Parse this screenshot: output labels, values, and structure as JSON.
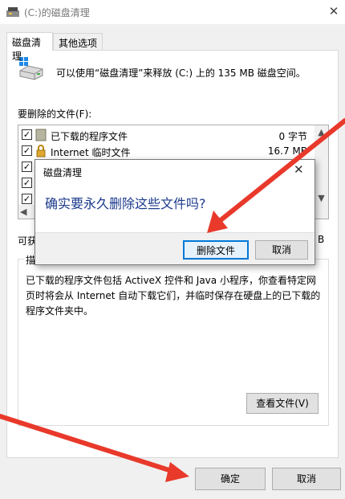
{
  "window": {
    "title": "(C:)的磁盘清理",
    "close_glyph": "✕"
  },
  "tabs": [
    {
      "label": "磁盘清理",
      "active": true
    },
    {
      "label": "其他选项",
      "active": false
    }
  ],
  "info_text": "可以使用“磁盘清理”来释放  (C:) 上的 135 MB 磁盘空间。",
  "files_label": "要删除的文件(F):",
  "file_list": [
    {
      "checked": true,
      "icon": "folder-icon",
      "name": "已下载的程序文件",
      "size": "0 字节"
    },
    {
      "checked": true,
      "icon": "lock-icon",
      "name": "Internet 临时文件",
      "size": "16.7 MB"
    },
    {
      "checked": true,
      "icon": "",
      "name": "",
      "size": ""
    },
    {
      "checked": true,
      "icon": "",
      "name": "",
      "size": ""
    },
    {
      "checked": true,
      "icon": "",
      "name": "",
      "size": ""
    }
  ],
  "obtain_label": "可获",
  "obtain_size": "B",
  "description": {
    "label": "描",
    "text": "已下载的程序文件包括 ActiveX 控件和 Java 小程序，你查看特定网页时将会从 Internet 自动下载它们，并临时保存在硬盘上的已下载的程序文件夹中。"
  },
  "buttons": {
    "view_files": "查看文件(V)",
    "ok": "确定",
    "cancel": "取消"
  },
  "dialog": {
    "title": "磁盘清理",
    "close_glyph": "✕",
    "question": "确实要永久删除这些文件吗?",
    "delete_label": "删除文件",
    "cancel_label": "取消"
  },
  "colors": {
    "accent_border": "#0078d7",
    "question_text": "#1b3a8c",
    "annotation_arrow": "#e8392b"
  }
}
